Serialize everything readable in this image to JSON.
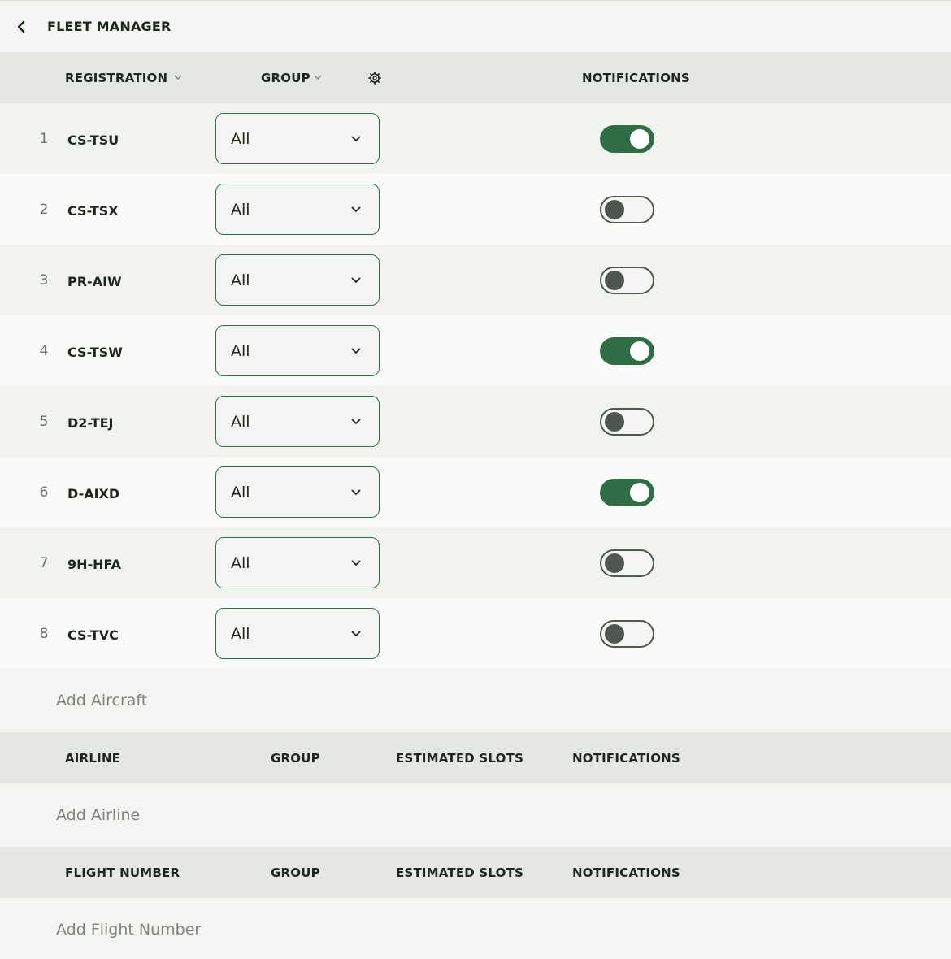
{
  "topbar": {
    "title": "FLEET MANAGER",
    "back_icon": "chevron-left-icon"
  },
  "fleet_table": {
    "headers": {
      "registration": "REGISTRATION",
      "group": "GROUP",
      "notifications": "NOTIFICATIONS"
    },
    "rows": [
      {
        "num": "1",
        "registration": "CS-TSU",
        "group": "All",
        "notifications": true
      },
      {
        "num": "2",
        "registration": "CS-TSX",
        "group": "All",
        "notifications": false
      },
      {
        "num": "3",
        "registration": "PR-AIW",
        "group": "All",
        "notifications": false
      },
      {
        "num": "4",
        "registration": "CS-TSW",
        "group": "All",
        "notifications": true
      },
      {
        "num": "5",
        "registration": "D2-TEJ",
        "group": "All",
        "notifications": false
      },
      {
        "num": "6",
        "registration": "D-AIXD",
        "group": "All",
        "notifications": true
      },
      {
        "num": "7",
        "registration": "9H-HFA",
        "group": "All",
        "notifications": false
      },
      {
        "num": "8",
        "registration": "CS-TVC",
        "group": "All",
        "notifications": false
      }
    ],
    "add_label": "Add Aircraft"
  },
  "airline_table": {
    "headers": {
      "airline": "AIRLINE",
      "group": "GROUP",
      "estimated_slots": "ESTIMATED SLOTS",
      "notifications": "NOTIFICATIONS"
    },
    "add_label": "Add Airline"
  },
  "flight_table": {
    "headers": {
      "flight_number": "FLIGHT NUMBER",
      "group": "GROUP",
      "estimated_slots": "ESTIMATED SLOTS",
      "notifications": "NOTIFICATIONS"
    },
    "add_label": "Add Flight Number"
  },
  "colors": {
    "accent": "#2f6e45",
    "toggle_off": "#4f5751",
    "header_bg": "#e4e7e2"
  }
}
